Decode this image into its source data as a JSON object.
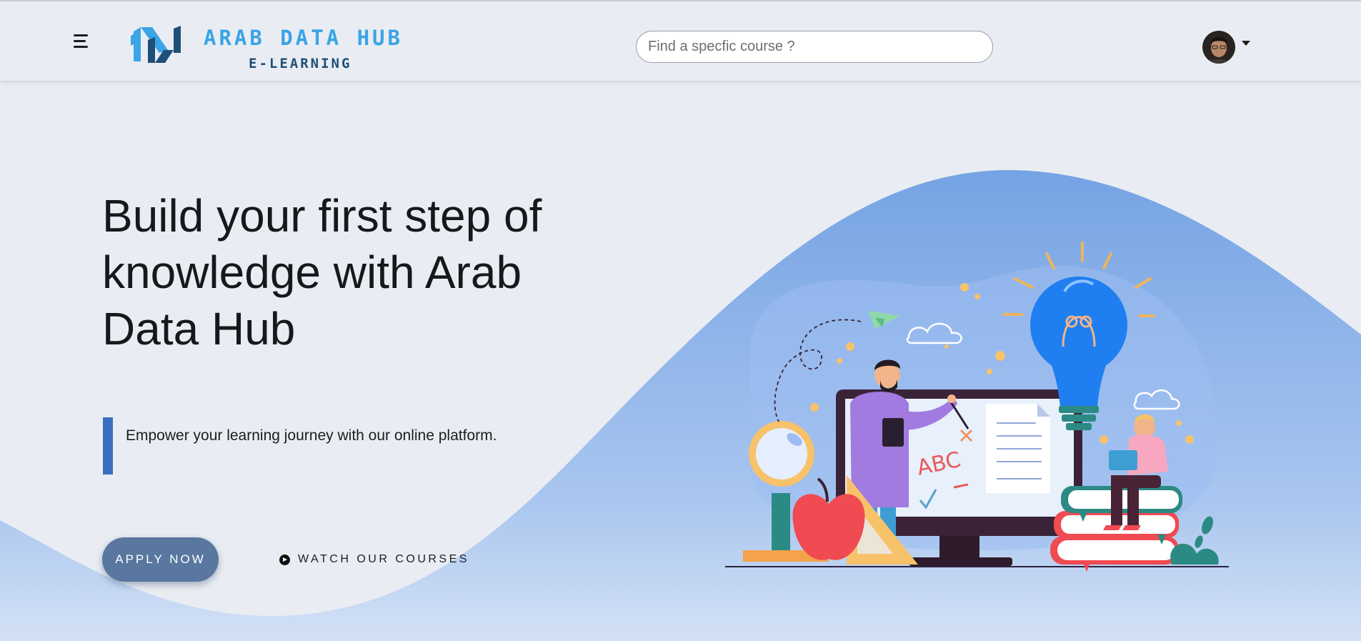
{
  "header": {
    "brand_title": "ARAB DATA HUB",
    "brand_subtitle": "E-LEARNING",
    "search_placeholder": "Find a specfic course ?",
    "search_value": ""
  },
  "hero": {
    "title": "Build your first step of knowledge with Arab Data Hub",
    "tagline": "Empower your learning journey with our online platform.",
    "apply_label": "APPLY NOW",
    "watch_label": "WATCH OUR COURSES"
  },
  "illustration": {
    "letters": "ABC",
    "icons": [
      "lightbulb-icon",
      "magnifier-icon",
      "apple-icon",
      "paper-plane-icon",
      "cloud-icon"
    ]
  },
  "colors": {
    "brand_blue": "#3aa4e6",
    "brand_navy": "#1e4f78",
    "accent_bar": "#3a6fc0",
    "apply_button": "#59779f",
    "wave": "#7aa6e6"
  }
}
